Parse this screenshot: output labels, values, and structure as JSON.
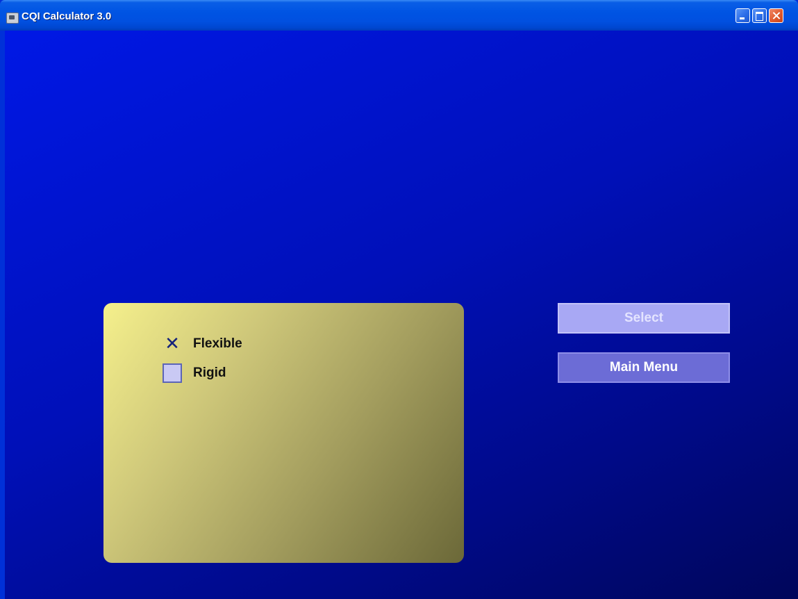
{
  "window": {
    "title": "CQI Calculator 3.0"
  },
  "options": {
    "flexible": {
      "label": "Flexible",
      "checked": true,
      "mark": "✕"
    },
    "rigid": {
      "label": "Rigid",
      "checked": false
    }
  },
  "buttons": {
    "select_label": "Select",
    "main_menu_label": "Main Menu"
  },
  "colors": {
    "background": "#0018e6",
    "panel": "#cfc87a",
    "select_button": "#a8a8f4",
    "main_menu_button": "#6c6cd6",
    "close_button": "#e05a2c"
  }
}
